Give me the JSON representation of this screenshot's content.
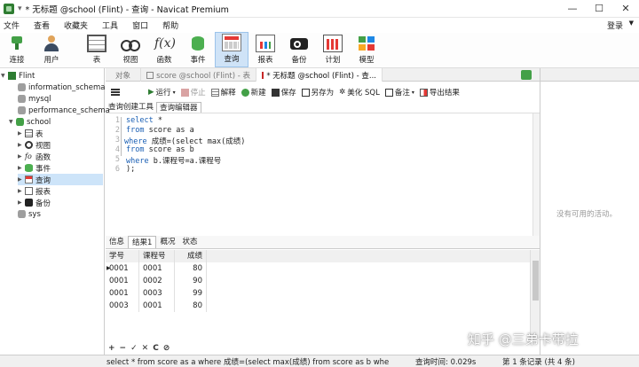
{
  "window": {
    "title": "* 无标题 @school (Flint) - 查询 - Navicat Premium",
    "controls": [
      "—",
      "☐",
      "✕"
    ]
  },
  "menu": [
    "文件",
    "查看",
    "收藏夹",
    "工具",
    "窗口",
    "帮助"
  ],
  "login": "登录",
  "toolbar": [
    {
      "label": "连接",
      "icon": "connect-icon"
    },
    {
      "label": "用户",
      "icon": "user-icon"
    },
    {
      "label": "表",
      "icon": "table-icon"
    },
    {
      "label": "视图",
      "icon": "view-icon"
    },
    {
      "label": "函数",
      "icon": "function-icon",
      "glyph": "f(x)"
    },
    {
      "label": "事件",
      "icon": "event-icon"
    },
    {
      "label": "查询",
      "icon": "query-icon",
      "active": true
    },
    {
      "label": "报表",
      "icon": "report-icon"
    },
    {
      "label": "备份",
      "icon": "backup-icon"
    },
    {
      "label": "计划",
      "icon": "schedule-icon"
    },
    {
      "label": "模型",
      "icon": "model-icon"
    }
  ],
  "tree": {
    "root": "Flint",
    "databases": [
      "information_schema",
      "mysql",
      "performance_schema"
    ],
    "school": {
      "label": "school",
      "children": [
        "表",
        "视图",
        "函数",
        "事件",
        "查询",
        "报表",
        "备份"
      ]
    },
    "sys": "sys",
    "fx_glyph": "fo"
  },
  "tabs": [
    "对象",
    "score @school (Flint) - 表",
    "* 无标题 @school (Flint) - 查..."
  ],
  "query_toolbar": {
    "run": "运行",
    "stop": "停止",
    "explain": "解释",
    "new": "新建",
    "save": "保存",
    "save_as": "另存为",
    "beautify": "美化 SQL",
    "comment": "备注",
    "export": "导出结果"
  },
  "sub_tabs": [
    "查询创建工具",
    "查询编辑器"
  ],
  "sql_lines": [
    {
      "n": "1",
      "kw": "select",
      "rest": " *"
    },
    {
      "n": "2",
      "kw": "from",
      "rest": " score as a"
    },
    {
      "n": "3",
      "kw": "where",
      "rest": " 成绩=(select max(成绩)"
    },
    {
      "n": "4",
      "kw": "from",
      "rest": " score as b"
    },
    {
      "n": "5",
      "kw": "where",
      "rest": " b.课程号=a.课程号"
    },
    {
      "n": "6",
      "kw": "",
      "rest": ");"
    }
  ],
  "result_tabs": [
    "信息",
    "结果1",
    "概况",
    "状态"
  ],
  "grid": {
    "headers": [
      "学号",
      "课程号",
      "成绩"
    ],
    "rows": [
      [
        "0001",
        "0001",
        "80"
      ],
      [
        "0001",
        "0002",
        "90"
      ],
      [
        "0001",
        "0003",
        "99"
      ],
      [
        "0003",
        "0001",
        "80"
      ]
    ]
  },
  "grid_bar": [
    "+",
    "−",
    "✓",
    "✕",
    "C",
    "⊘"
  ],
  "right_panel_msg": "没有可用的活动。",
  "status": {
    "sql": "select * from score as a where 成绩=(select max(成绩) from score as b whe",
    "time": "查询时间: 0.029s",
    "records": "第 1 条记录 (共 4 条)"
  },
  "watermark": "知乎 @三弟卡带拉"
}
